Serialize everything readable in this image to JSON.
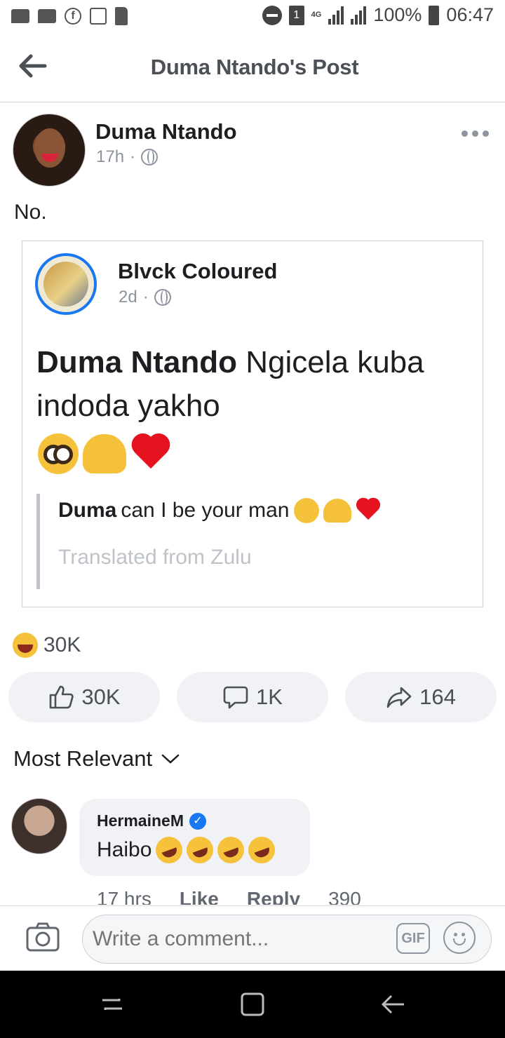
{
  "status_bar": {
    "network": "4G",
    "sim": "1",
    "battery": "100%",
    "time": "06:47"
  },
  "header": {
    "title": "Duma Ntando's Post",
    "back_icon": "arrow-left-icon"
  },
  "post": {
    "author": "Duma Ntando",
    "time": "17h",
    "separator": "·",
    "privacy_icon": "globe-icon",
    "text": "No.",
    "shared": {
      "author": "Blvck Coloured",
      "time": "2d",
      "separator": "·",
      "body_bold": "Duma Ntando",
      "body_rest": " Ngicela kuba indoda yakho",
      "emojis": [
        "pleading-face",
        "raising-hands",
        "red-heart"
      ],
      "translation_bold": "Duma",
      "translation_rest": "can I be your man",
      "translation_note": "Translated from Zulu"
    }
  },
  "reactions": {
    "summary_count": "30K",
    "like_count": "30K",
    "comment_count": "1K",
    "share_count": "164"
  },
  "comments": {
    "sort_label": "Most Relevant",
    "items": [
      {
        "author": "HermaineM",
        "verified": true,
        "text": "Haibo",
        "emoji_count": 4,
        "time": "17 hrs",
        "like": "Like",
        "reply": "Reply",
        "reaction_count": "390"
      }
    ]
  },
  "composer": {
    "placeholder": "Write a comment...",
    "gif_label": "GIF"
  },
  "colors": {
    "accent": "#1877f2",
    "muted": "#8d949e",
    "pill_bg": "#f0f2f5"
  }
}
